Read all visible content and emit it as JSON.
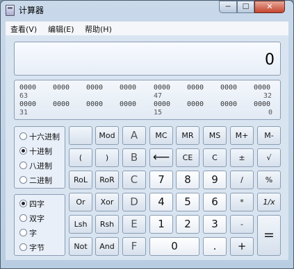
{
  "window": {
    "title": "计算器",
    "minimize": "─",
    "maximize": "☐",
    "close": "✕"
  },
  "menu": {
    "view": "查看(V)",
    "edit": "编辑(E)",
    "help": "帮助(H)"
  },
  "display": {
    "value": "0"
  },
  "bits": {
    "row1": [
      "0000",
      "0000",
      "0000",
      "0000",
      "0000",
      "0000",
      "0000",
      "0000"
    ],
    "row1_labels": [
      "63",
      "47",
      "32"
    ],
    "row2": [
      "0000",
      "0000",
      "0000",
      "0000",
      "0000",
      "0000",
      "0000",
      "0000"
    ],
    "row2_labels": [
      "31",
      "15",
      "0"
    ]
  },
  "base_modes": {
    "selected": "十进制",
    "items": [
      "十六进制",
      "十进制",
      "八进制",
      "二进制"
    ]
  },
  "word_sizes": {
    "selected": "四字",
    "items": [
      "四字",
      "双字",
      "字",
      "字节"
    ]
  },
  "keys": {
    "blank": "",
    "mod": "Mod",
    "a": "A",
    "mc": "MC",
    "mr": "MR",
    "ms": "MS",
    "mplus": "M+",
    "mminus": "M-",
    "lparen": "(",
    "rparen": ")",
    "b": "B",
    "backspace": "⟵",
    "ce": "CE",
    "c": "C",
    "plusminus": "±",
    "sqrt": "√",
    "rol": "RoL",
    "ror": "RoR",
    "c_hex": "C",
    "seven": "7",
    "eight": "8",
    "nine": "9",
    "divide": "/",
    "percent": "%",
    "or": "Or",
    "xor": "Xor",
    "d": "D",
    "four": "4",
    "five": "5",
    "six": "6",
    "multiply": "*",
    "reciprocal": "1/x",
    "lsh": "Lsh",
    "rsh": "Rsh",
    "e": "E",
    "one": "1",
    "two": "2",
    "three": "3",
    "minus": "-",
    "equals": "=",
    "not": "Not",
    "and": "And",
    "f": "F",
    "zero": "0",
    "dot": ".",
    "plus": "+"
  }
}
